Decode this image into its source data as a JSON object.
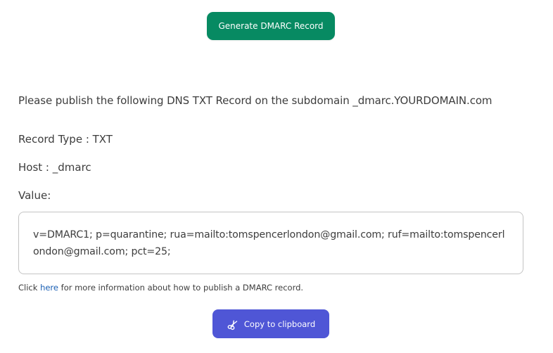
{
  "generate_button": {
    "label": "Generate DMARC Record",
    "color": "#078a62"
  },
  "instruction": "Please publish the following DNS TXT Record on the subdomain _dmarc.YOURDOMAIN.com",
  "record_type": "Record Type : TXT",
  "host": "Host : _dmarc",
  "value_label": "Value:",
  "value": "v=DMARC1; p=quarantine; rua=mailto:tomspencerlondon@gmail.com; ruf=mailto:tomspencerlondon@gmail.com; pct=25;",
  "help": {
    "prefix": "Click ",
    "link": "here",
    "suffix": " for more information about how to publish a DMARC record."
  },
  "copy_button": {
    "label": "Copy to clipboard",
    "icon": "scissors-icon",
    "color": "#4f56d6"
  }
}
